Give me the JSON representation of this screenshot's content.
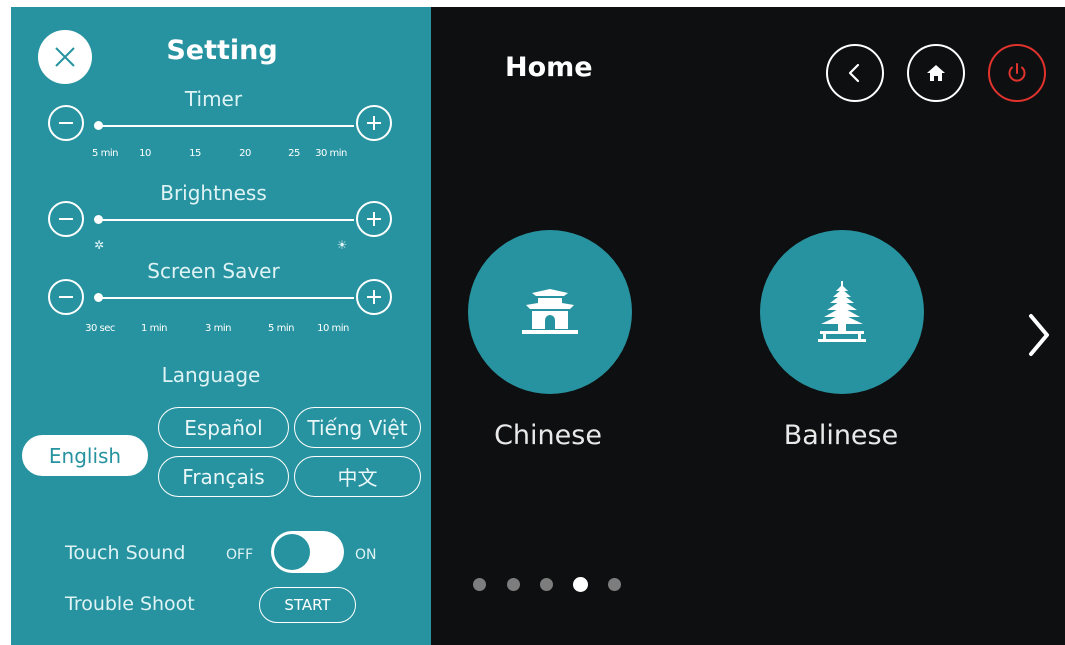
{
  "settings": {
    "title": "Setting",
    "timer": {
      "label": "Timer",
      "ticks": [
        "5 min",
        "10",
        "15",
        "20",
        "25",
        "30 min"
      ],
      "value": "5 min"
    },
    "brightness": {
      "label": "Brightness",
      "min_icon": "dim-sun-icon",
      "max_icon": "bright-sun-icon",
      "level": 0
    },
    "screen_saver": {
      "label": "Screen Saver",
      "ticks": [
        "30 sec",
        "1 min",
        "3 min",
        "5 min",
        "10 min"
      ],
      "value": "30 sec"
    },
    "language": {
      "label": "Language",
      "options": [
        "English",
        "Español",
        "Tiếng Việt",
        "Français",
        "中文"
      ],
      "selected": "English"
    },
    "touch_sound": {
      "label": "Touch Sound",
      "off_label": "OFF",
      "on_label": "ON",
      "state": "ON"
    },
    "trouble_shoot": {
      "label": "Trouble Shoot",
      "button": "START"
    }
  },
  "home": {
    "title": "Home",
    "header_icons": [
      "back-icon",
      "home-icon",
      "power-icon"
    ],
    "cuisines": [
      {
        "label": "Chinese",
        "icon": "chinese-gate-icon"
      },
      {
        "label": "Balinese",
        "icon": "balinese-pagoda-icon"
      }
    ],
    "pagination": {
      "total": 5,
      "current": 4
    }
  },
  "colors": {
    "panel": "#2793a0",
    "background": "#0e0f10",
    "power": "#e0332e",
    "dot_inactive": "#7d7d7d"
  }
}
